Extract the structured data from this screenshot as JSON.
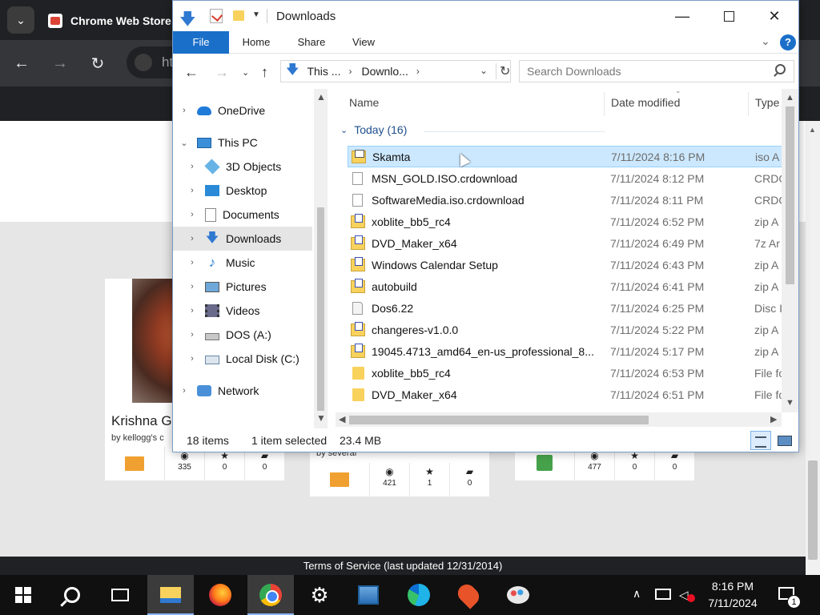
{
  "browser": {
    "tab_title": "Chrome Web Store",
    "tab_menu_icon": "chevron-down-icon",
    "omnibox_text": "ht",
    "page": {
      "terms": "Terms of Service (last updated 12/31/2014)",
      "cards": [
        {
          "title": "Krishna G",
          "byline": "by kellogg's c",
          "views": "335",
          "stars": "0",
          "comments": "0"
        },
        {
          "title": "",
          "byline": "by several",
          "views": "421",
          "stars": "1",
          "comments": "0"
        },
        {
          "title": "",
          "byline": "",
          "views": "477",
          "stars": "0",
          "comments": "0"
        }
      ]
    }
  },
  "explorer": {
    "title": "Downloads",
    "ribbon": {
      "file": "File",
      "home": "Home",
      "share": "Share",
      "view": "View",
      "help": "?"
    },
    "address": {
      "seg1": "This ...",
      "seg2": "Downlo...",
      "chev": "›"
    },
    "search_placeholder": "Search Downloads",
    "nav_items": [
      {
        "label": "OneDrive"
      },
      {
        "label": "This PC"
      },
      {
        "label": "3D Objects"
      },
      {
        "label": "Desktop"
      },
      {
        "label": "Documents"
      },
      {
        "label": "Downloads"
      },
      {
        "label": "Music"
      },
      {
        "label": "Pictures"
      },
      {
        "label": "Videos"
      },
      {
        "label": "DOS (A:)"
      },
      {
        "label": "Local Disk (C:)"
      },
      {
        "label": "Network"
      }
    ],
    "columns": {
      "name": "Name",
      "date": "Date modified",
      "type": "Type"
    },
    "group": "Today (16)",
    "files": [
      {
        "name": "Skamta",
        "date": "7/11/2024 8:16 PM",
        "type": "iso A",
        "icon": "iso-archive-icon"
      },
      {
        "name": "MSN_GOLD.ISO.crdownload",
        "date": "7/11/2024 8:12 PM",
        "type": "CRDO",
        "icon": "document-icon"
      },
      {
        "name": "SoftwareMedia.iso.crdownload",
        "date": "7/11/2024 8:11 PM",
        "type": "CRDO",
        "icon": "document-icon"
      },
      {
        "name": "xoblite_bb5_rc4",
        "date": "7/11/2024 6:52 PM",
        "type": "zip A",
        "icon": "zip-archive-icon"
      },
      {
        "name": "DVD_Maker_x64",
        "date": "7/11/2024 6:49 PM",
        "type": "7z Ar",
        "icon": "zip-archive-icon"
      },
      {
        "name": "Windows Calendar Setup",
        "date": "7/11/2024 6:43 PM",
        "type": "zip A",
        "icon": "zip-archive-icon"
      },
      {
        "name": "autobuild",
        "date": "7/11/2024 6:41 PM",
        "type": "zip A",
        "icon": "zip-archive-icon"
      },
      {
        "name": "Dos6.22",
        "date": "7/11/2024 6:25 PM",
        "type": "Disc I",
        "icon": "disc-image-icon"
      },
      {
        "name": "changeres-v1.0.0",
        "date": "7/11/2024 5:22 PM",
        "type": "zip A",
        "icon": "zip-archive-icon"
      },
      {
        "name": "19045.4713_amd64_en-us_professional_8...",
        "date": "7/11/2024 5:17 PM",
        "type": "zip A",
        "icon": "zip-archive-icon"
      },
      {
        "name": "xoblite_bb5_rc4",
        "date": "7/11/2024 6:53 PM",
        "type": "File fo",
        "icon": "folder-icon"
      },
      {
        "name": "DVD_Maker_x64",
        "date": "7/11/2024 6:51 PM",
        "type": "File fo",
        "icon": "folder-icon"
      }
    ],
    "status": {
      "count": "18 items",
      "selected": "1 item selected",
      "size": "23.4 MB"
    }
  },
  "taskbar": {
    "clock_time": "8:16 PM",
    "clock_date": "7/11/2024",
    "notification_count": "1"
  }
}
